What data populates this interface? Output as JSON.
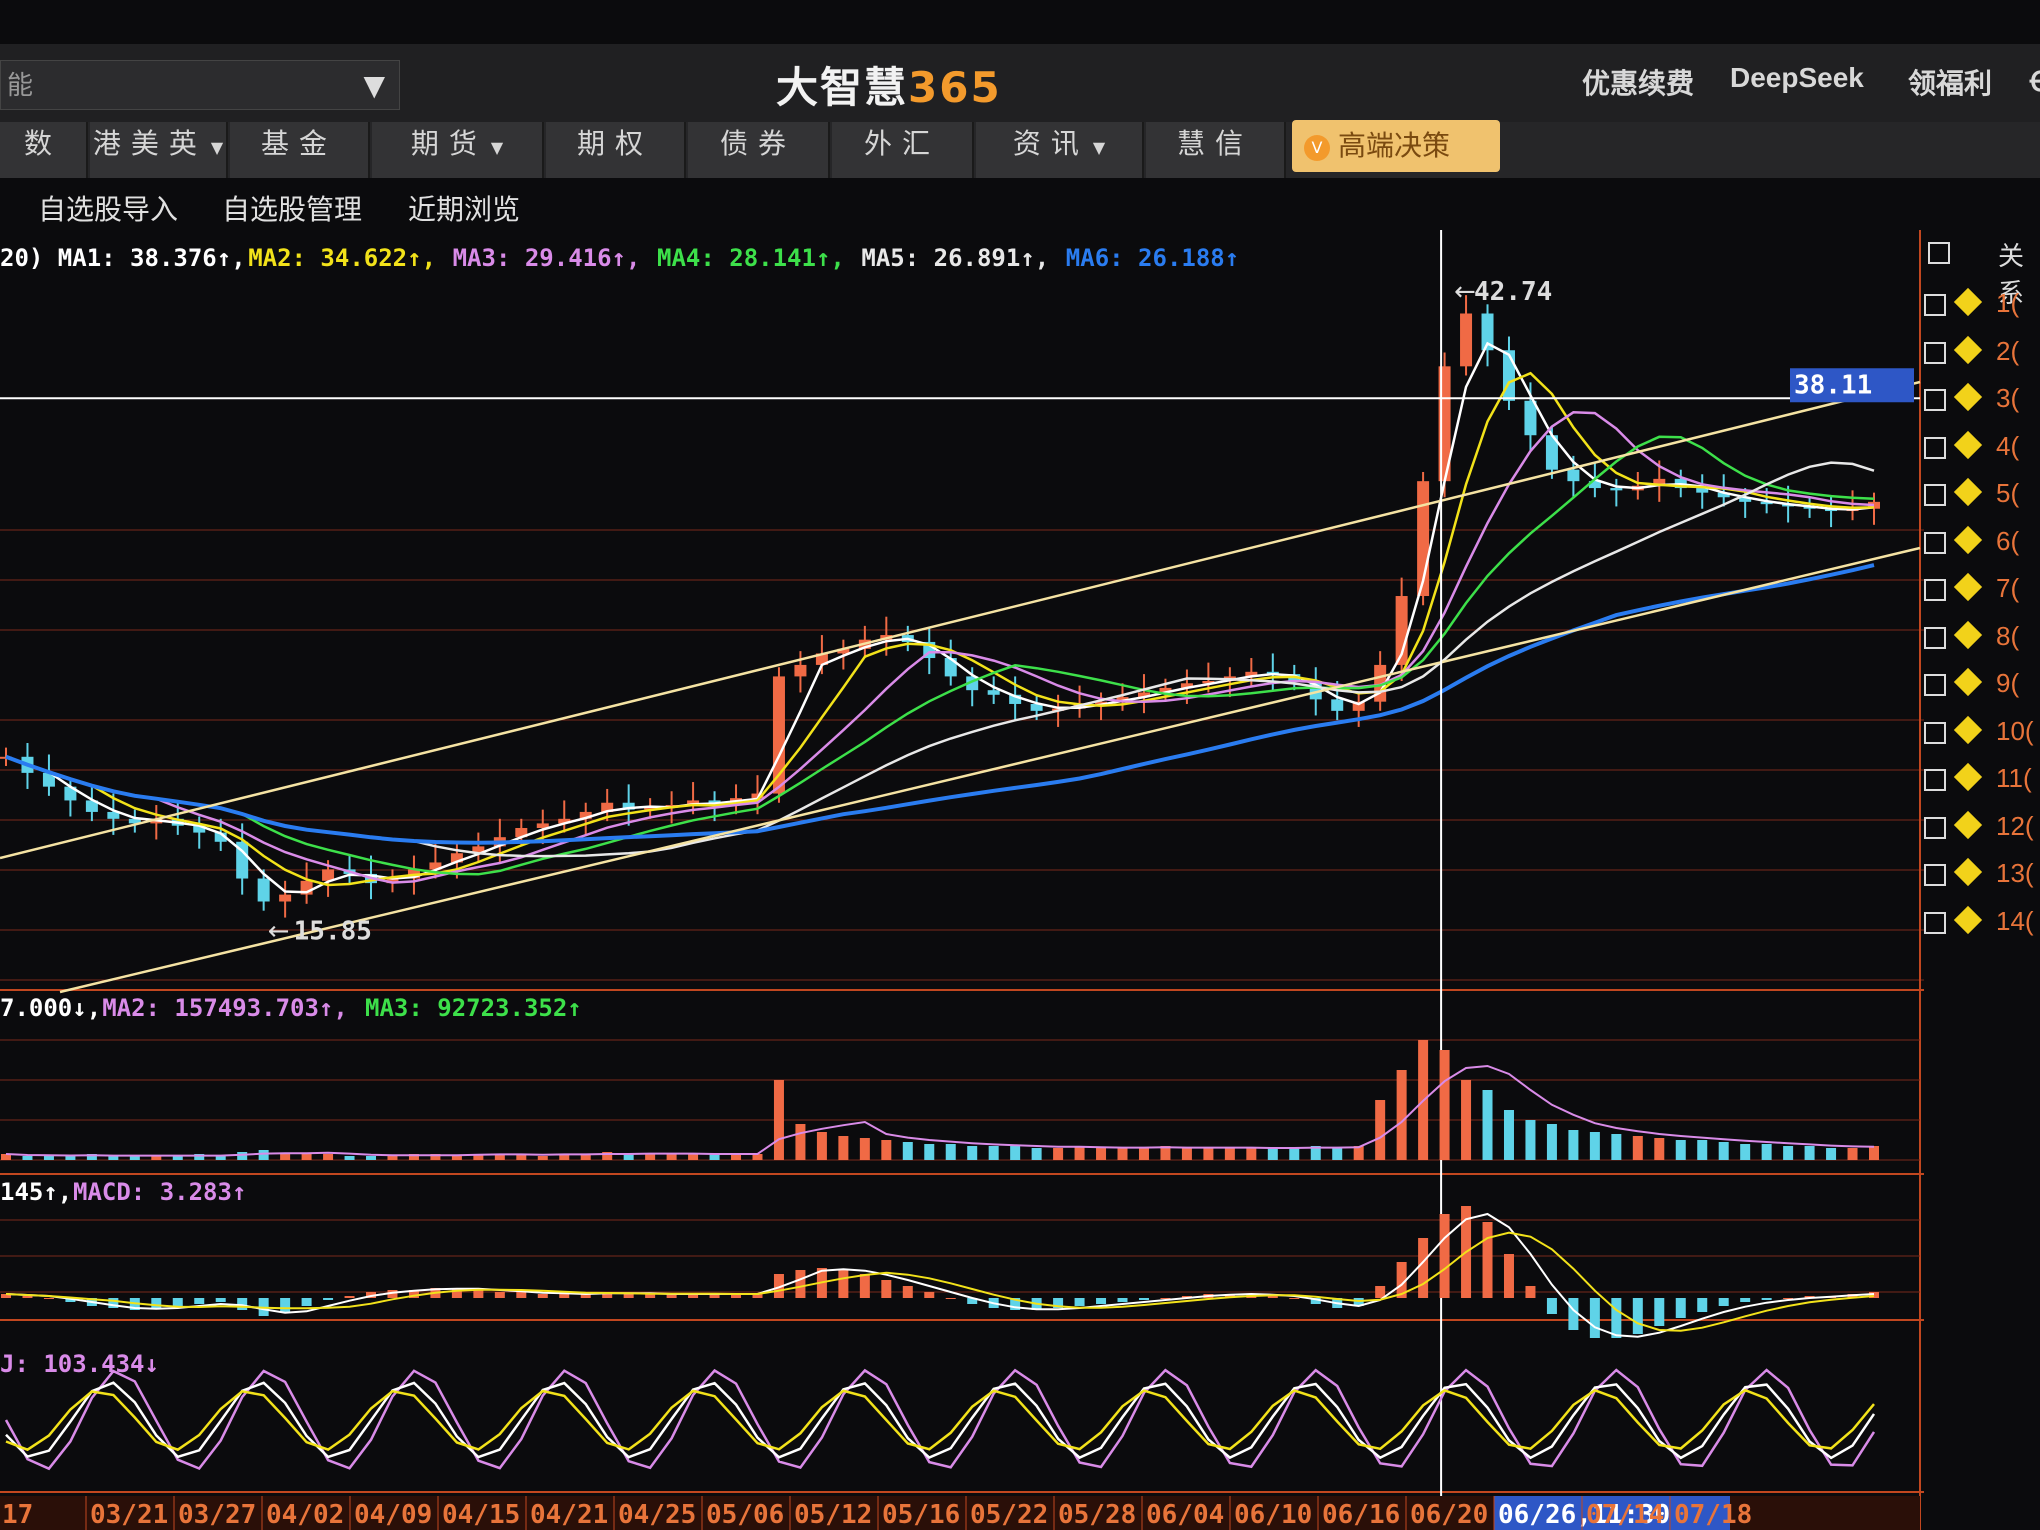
{
  "header": {
    "search_text": "能",
    "title_part1": "大智慧",
    "title_part2": "365",
    "links": [
      "优惠续费",
      "DeepSeek",
      "领福利",
      "Ꞓ"
    ]
  },
  "nav": {
    "tabs": [
      {
        "label": "数",
        "dropdown": false
      },
      {
        "label": "港美英",
        "dropdown": true
      },
      {
        "label": "基金",
        "dropdown": false
      },
      {
        "label": "期货",
        "dropdown": true
      },
      {
        "label": "期权",
        "dropdown": false
      },
      {
        "label": "债券",
        "dropdown": false
      },
      {
        "label": "外汇",
        "dropdown": false
      },
      {
        "label": "资讯",
        "dropdown": true
      },
      {
        "label": "慧信",
        "dropdown": false
      }
    ],
    "premium_label": "高端决策"
  },
  "subnav": [
    "自选股导入",
    "自选股管理",
    "近期浏览"
  ],
  "indicators": {
    "ma_line": [
      {
        "text": "20) MA1: 38.376↑,",
        "color": "#ffffff"
      },
      {
        "text": " MA2: 34.622↑,",
        "color": "#f2e21a"
      },
      {
        "text": " MA3: 29.416↑,",
        "color": "#d98be8"
      },
      {
        "text": " MA4: 28.141↑,",
        "color": "#3de04a"
      },
      {
        "text": " MA5: 26.891↑,",
        "color": "#e8e8e8"
      },
      {
        "text": " MA6: 26.188↑",
        "color": "#2a7cf0"
      }
    ],
    "vol_line": [
      {
        "text": "7.000↓,",
        "color": "#ffffff"
      },
      {
        "text": " MA2: 157493.703↑,",
        "color": "#d98be8"
      },
      {
        "text": " MA3: 92723.352↑",
        "color": "#3de04a"
      }
    ],
    "macd_line": [
      {
        "text": "145↑,",
        "color": "#ffffff"
      },
      {
        "text": " MACD: 3.283↑",
        "color": "#d98be8"
      }
    ],
    "kdj_line": [
      {
        "text": "J: 103.434↓",
        "color": "#d98be8"
      }
    ]
  },
  "price_labels": {
    "high": "42.74",
    "low": "15.85",
    "crosshair_price": "38.11"
  },
  "date_axis": [
    "17",
    "03/21",
    "03/27",
    "04/02",
    "04/09",
    "04/15",
    "04/21",
    "04/25",
    "05/06",
    "05/12",
    "05/16",
    "05/22",
    "05/28",
    "06/04",
    "06/10",
    "06/16",
    "06/20",
    "06/26,11:30",
    "07/14",
    "07/18"
  ],
  "side_panel": {
    "header": "关系",
    "rows": [
      "1(",
      "2(",
      "3(",
      "4(",
      "5(",
      "6(",
      "7(",
      "8(",
      "9(",
      "10(",
      "11(",
      "12(",
      "13(",
      "14("
    ]
  },
  "colors": {
    "up": "#f06a45",
    "down": "#5fd3e8",
    "ma1": "#ffffff",
    "ma2": "#f2e21a",
    "ma3": "#d98be8",
    "ma4": "#3de04a",
    "ma5": "#e8e8e8",
    "ma6": "#2a7cf0",
    "grid": "#7a2a1a",
    "trend": "#f5e3a3"
  },
  "chart_data": {
    "type": "candlestick",
    "y_range": [
      13,
      45
    ],
    "trading_days": 88,
    "close_series": [
      22.5,
      21.8,
      21.2,
      20.6,
      20.1,
      19.8,
      19.6,
      19.8,
      19.5,
      19.2,
      18.8,
      17.2,
      16.2,
      16.5,
      17.1,
      17.6,
      17.4,
      17.0,
      17.2,
      17.6,
      17.9,
      18.3,
      18.6,
      19.0,
      19.4,
      19.6,
      19.8,
      20.1,
      20.5,
      20.2,
      20.3,
      20.4,
      20.6,
      20.4,
      20.7,
      20.9,
      26.0,
      26.5,
      27.0,
      27.2,
      27.6,
      27.8,
      27.5,
      26.8,
      26.0,
      25.4,
      25.2,
      24.8,
      24.5,
      24.6,
      24.8,
      24.9,
      25.1,
      25.3,
      25.5,
      25.7,
      25.8,
      26.0,
      26.2,
      26.1,
      25.8,
      25.0,
      24.5,
      24.9,
      26.5,
      29.5,
      34.5,
      39.5,
      41.8,
      40.2,
      38.0,
      36.5,
      35.0,
      34.5,
      34.2,
      34.1,
      34.3,
      34.6,
      34.2,
      34.0,
      33.8,
      33.6,
      33.5,
      33.4,
      33.3,
      33.2,
      33.3,
      33.6
    ],
    "volume_series": [
      3,
      2,
      2,
      2,
      3,
      2,
      2,
      2,
      2,
      3,
      2,
      4,
      5,
      3,
      3,
      3,
      2,
      2,
      2,
      3,
      3,
      2,
      3,
      3,
      3,
      2,
      3,
      3,
      4,
      3,
      3,
      3,
      3,
      3,
      3,
      3,
      40,
      18,
      14,
      12,
      11,
      10,
      9,
      8,
      8,
      7,
      7,
      7,
      6,
      6,
      7,
      6,
      6,
      6,
      7,
      6,
      6,
      6,
      6,
      6,
      6,
      7,
      6,
      7,
      30,
      45,
      60,
      55,
      40,
      35,
      25,
      20,
      18,
      15,
      14,
      13,
      12,
      11,
      10,
      10,
      9,
      8,
      8,
      7,
      7,
      6,
      6,
      7
    ],
    "macd_hist": [
      0.2,
      0.1,
      0.0,
      -0.2,
      -0.4,
      -0.5,
      -0.6,
      -0.5,
      -0.4,
      -0.3,
      -0.2,
      -0.6,
      -0.9,
      -0.7,
      -0.4,
      -0.1,
      0.1,
      0.3,
      0.4,
      0.4,
      0.5,
      0.5,
      0.4,
      0.3,
      0.3,
      0.2,
      0.2,
      0.2,
      0.3,
      0.2,
      0.2,
      0.2,
      0.2,
      0.2,
      0.2,
      0.2,
      1.2,
      1.4,
      1.5,
      1.4,
      1.2,
      0.9,
      0.6,
      0.3,
      0.0,
      -0.3,
      -0.5,
      -0.6,
      -0.6,
      -0.5,
      -0.4,
      -0.3,
      -0.2,
      -0.1,
      0.0,
      0.1,
      0.2,
      0.2,
      0.2,
      0.1,
      0.0,
      -0.3,
      -0.5,
      -0.4,
      0.6,
      1.8,
      3.0,
      4.2,
      4.6,
      3.8,
      2.2,
      0.6,
      -0.8,
      -1.6,
      -2.0,
      -2.0,
      -1.8,
      -1.4,
      -1.0,
      -0.7,
      -0.4,
      -0.2,
      -0.1,
      0.0,
      0.1,
      0.1,
      0.2,
      0.3
    ],
    "high_marker": 42.74,
    "low_marker": 15.85,
    "crosshair": {
      "date": "06/26,11:30",
      "price": 38.11
    }
  }
}
